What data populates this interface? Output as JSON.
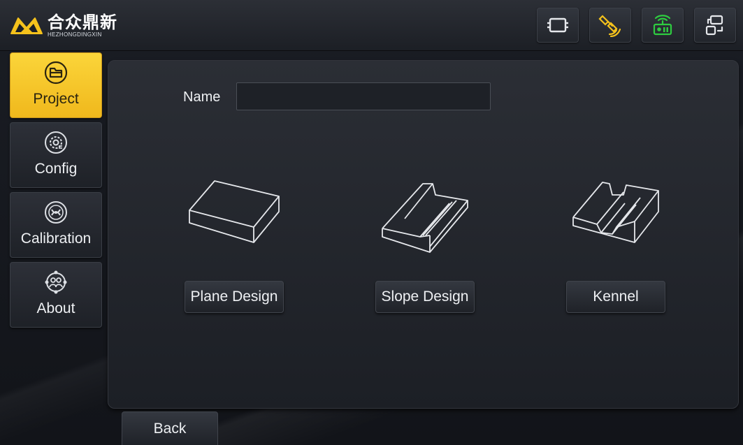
{
  "brand": {
    "name_cn": "合众鼎新",
    "name_en": "HEZHONGDINGXIN",
    "logo_color": "#f5c21c"
  },
  "topbar": {
    "icons": [
      {
        "name": "screen-frame-icon",
        "color": "#e6e8ec"
      },
      {
        "name": "satellite-icon",
        "color": "#f5c21c"
      },
      {
        "name": "radio-icon",
        "color": "#2ecc40"
      },
      {
        "name": "device-switch-icon",
        "color": "#e6e8ec"
      }
    ]
  },
  "sidebar": {
    "items": [
      {
        "label": "Project",
        "icon": "folder-icon",
        "active": true
      },
      {
        "label": "Config",
        "icon": "settings-gear-icon",
        "active": false
      },
      {
        "label": "Calibration",
        "icon": "calibration-icon",
        "active": false
      },
      {
        "label": "About",
        "icon": "about-network-icon",
        "active": false
      }
    ],
    "active_color": "#f5c21c"
  },
  "form": {
    "name_label": "Name",
    "name_value": "",
    "name_placeholder": ""
  },
  "designs": [
    {
      "label": "Plane Design",
      "icon": "plane-design-icon"
    },
    {
      "label": "Slope Design",
      "icon": "slope-design-icon"
    },
    {
      "label": "Kennel",
      "icon": "kennel-icon"
    }
  ],
  "footer": {
    "back_label": "Back"
  }
}
